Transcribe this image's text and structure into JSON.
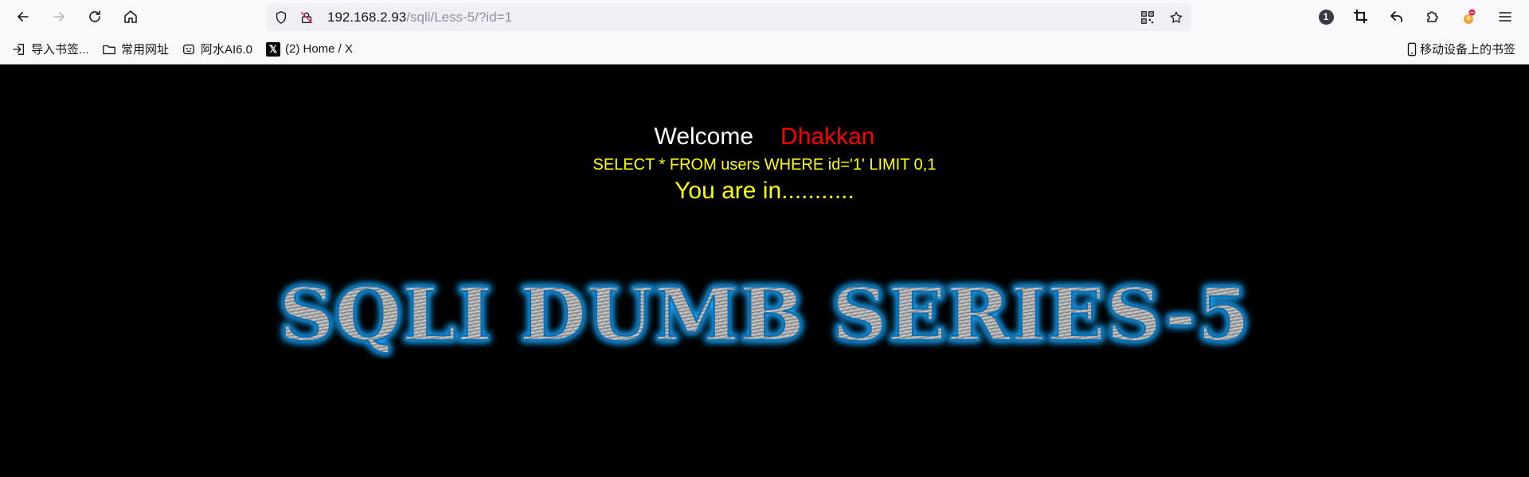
{
  "browser": {
    "url_host": "192.168.2.93",
    "url_path": "/sqli/Less-5/?id=1",
    "extension_badge": "1",
    "bookmarks": [
      {
        "label": "导入书签...",
        "icon": "import-icon"
      },
      {
        "label": "常用网址",
        "icon": "folder-icon"
      },
      {
        "label": "阿水AI6.0",
        "icon": "bot-icon"
      },
      {
        "label": "(2) Home / X",
        "icon": "x-logo-icon"
      }
    ],
    "mobile_bookmarks": "移动设备上的书签"
  },
  "page": {
    "welcome": "Welcome",
    "name": "Dhakkan",
    "query": "SELECT * FROM users WHERE id='1' LIMIT 0,1",
    "status": "You are in...........",
    "banner_title": "SQLI DUMB SERIES-5",
    "colors": {
      "background": "#000000",
      "name": "#ff0000",
      "query": "#ffff00",
      "banner_glow": "#1ea7ff"
    }
  }
}
